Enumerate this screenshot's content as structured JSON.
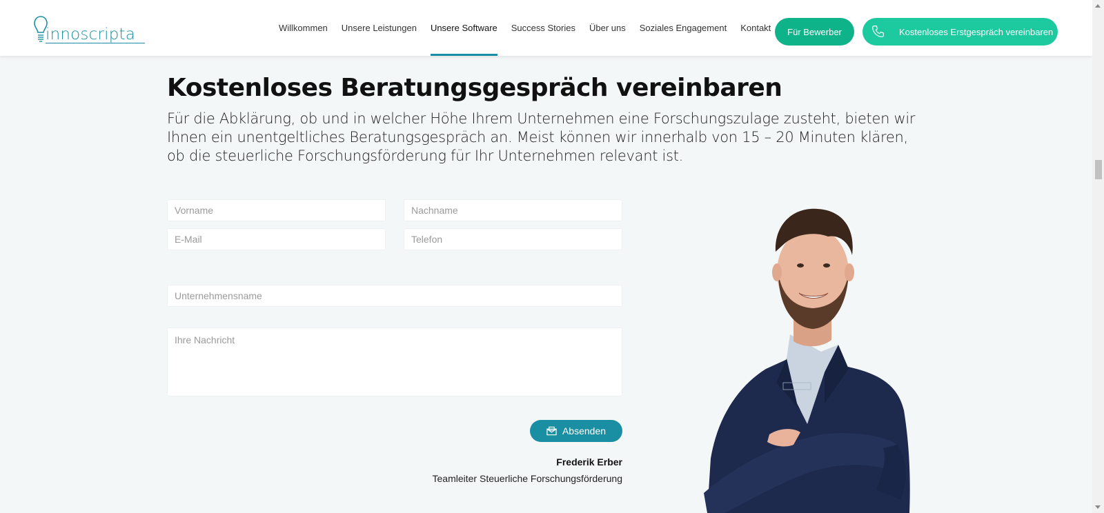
{
  "brand": {
    "name": "innoscripta",
    "color": "#1a8ea2"
  },
  "nav": {
    "items": [
      {
        "label": "Willkommen"
      },
      {
        "label": "Unsere Leistungen"
      },
      {
        "label": "Unsere Software",
        "active": true
      },
      {
        "label": "Success Stories"
      },
      {
        "label": "Über uns"
      },
      {
        "label": "Soziales Engagement"
      },
      {
        "label": "Kontakt"
      }
    ],
    "applicant_button": "Für Bewerber",
    "call_button": "Kostenloses Erstgespräch vereinbaren"
  },
  "main": {
    "title": "Kostenloses Beratungsgespräch vereinbaren",
    "lead": "Für die Abklärung, ob und in welcher Höhe Ihrem Unternehmen eine Forschungszulage zusteht, bieten wir Ihnen ein unentgeltliches Beratungsgespräch an. Meist können wir innerhalb von 15 – 20 Minuten klären, ob die steuerliche Forschungsförderung für Ihr Unternehmen relevant ist."
  },
  "form": {
    "firstname_placeholder": "Vorname",
    "lastname_placeholder": "Nachname",
    "email_placeholder": "E-Mail",
    "phone_placeholder": "Telefon",
    "company_placeholder": "Unternehmensname",
    "message_placeholder": "Ihre Nachricht",
    "submit_label": "Absenden"
  },
  "contact_person": {
    "name": "Frederik Erber",
    "role": "Teamleiter Steuerliche Forschungsförderung"
  },
  "colors": {
    "primary": "#1a8ea2",
    "green": "#0fb389",
    "mint": "#1dcaa0",
    "background": "#f3f7f7"
  },
  "icons": {
    "phone": "phone-icon",
    "mail": "mail-icon",
    "bulb": "lightbulb-icon"
  }
}
